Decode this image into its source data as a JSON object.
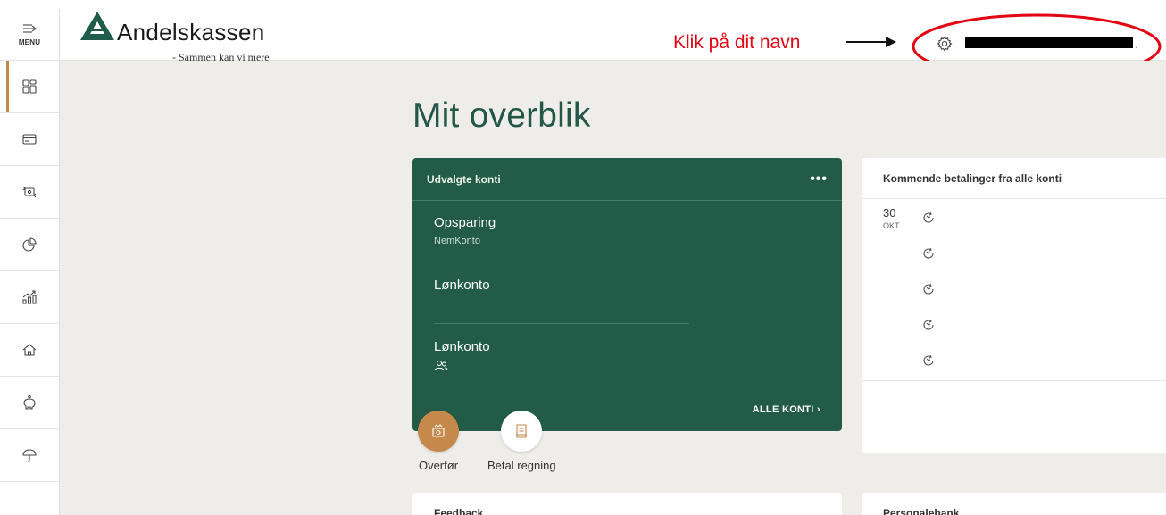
{
  "sidebar": {
    "menu_label": "MENU",
    "items": [
      {
        "name": "sidebar-item-overview",
        "icon": "grid-icon"
      },
      {
        "name": "sidebar-item-cards",
        "icon": "card-icon"
      },
      {
        "name": "sidebar-item-transfers",
        "icon": "transfer-icon"
      },
      {
        "name": "sidebar-item-budget",
        "icon": "pie-chart-icon"
      },
      {
        "name": "sidebar-item-investments",
        "icon": "chart-icon"
      },
      {
        "name": "sidebar-item-home",
        "icon": "house-icon"
      },
      {
        "name": "sidebar-item-savings",
        "icon": "piggy-bank-icon"
      },
      {
        "name": "sidebar-item-insurance",
        "icon": "umbrella-icon"
      }
    ]
  },
  "header": {
    "logo_name": "Andelskassen",
    "logo_tagline": "- Sammen kan vi mere",
    "annotation": "Klik på dit navn"
  },
  "main": {
    "title": "Mit overblik",
    "accounts_card": {
      "title": "Udvalgte konti",
      "menu_label": "•••",
      "accounts": [
        {
          "name": "Opsparing",
          "sub": "NemKonto"
        },
        {
          "name": "Lønkonto",
          "sub": ""
        },
        {
          "name": "Lønkonto",
          "sub": ""
        }
      ],
      "all_accounts_label": "ALLE KONTI ›"
    },
    "actions": [
      {
        "label": "Overfør"
      },
      {
        "label": "Betal regning"
      }
    ],
    "payments_card": {
      "title": "Kommende betalinger fra alle konti",
      "date_day": "30",
      "date_month": "OKT"
    },
    "bottom_cards": [
      {
        "title": "Feedback"
      },
      {
        "title": "Personalebank"
      }
    ]
  },
  "colors": {
    "brand_green": "#225c48",
    "accent_orange": "#c4894b",
    "annotation_red": "#e30613",
    "background": "#eeedea"
  }
}
